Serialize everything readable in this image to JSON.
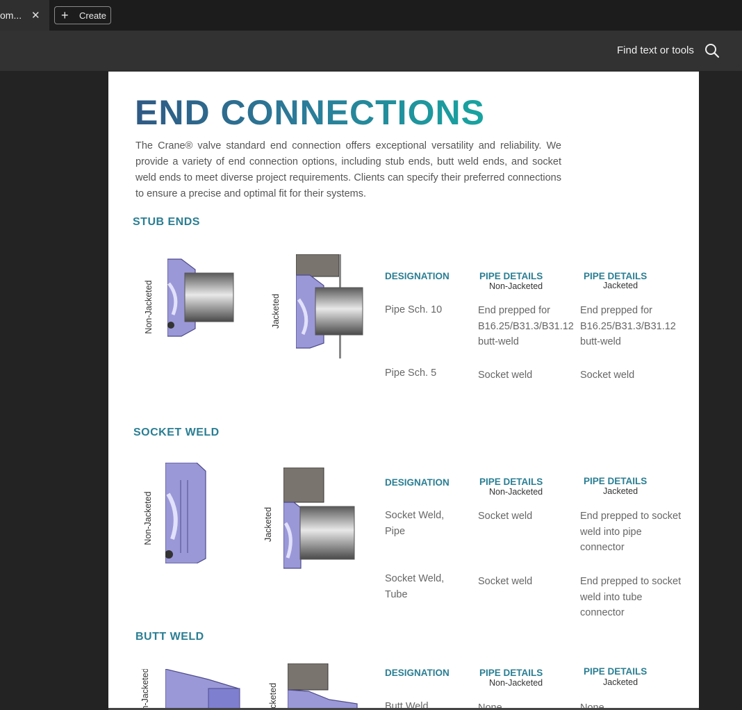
{
  "tabbar": {
    "tab_label": "om...",
    "close_glyph": "✕",
    "create_label": "Create"
  },
  "toolbar": {
    "find_label": "Find text or tools",
    "search_icon": "search-icon"
  },
  "doc": {
    "title": "END CONNECTIONS",
    "intro": "The Crane® valve standard end connection offers exceptional versatility and reliability. We provide a variety of end connection options, including stub ends, butt weld ends, and socket weld ends to meet diverse project requirements. Clients can specify their preferred connections to ensure a precise and optimal fit for their systems.",
    "colors": {
      "accent": "#2a7e93",
      "title_start": "#2f5a84",
      "title_end": "#17a4a0",
      "valve_body": "#9b98d8"
    },
    "sections": [
      {
        "title": "STUB ENDS",
        "label_non": "Non-Jacketed",
        "label_jac": "Jacketed",
        "headers": {
          "designation": "DESIGNATION",
          "pipe": "PIPE DETAILS",
          "non": "Non-Jacketed",
          "jac": "Jacketed"
        },
        "rows": [
          {
            "designation": "Pipe Sch. 10",
            "non": "End prepped for B16.25/B31.3/B31.12 butt-weld",
            "jac": "End prepped for B16.25/B31.3/B31.12 butt-weld"
          },
          {
            "designation": "Pipe Sch. 5",
            "non": "Socket weld",
            "jac": "Socket weld"
          }
        ]
      },
      {
        "title": "SOCKET WELD",
        "label_non": "Non-Jacketed",
        "label_jac": "Jacketed",
        "headers": {
          "designation": "DESIGNATION",
          "pipe": "PIPE DETAILS",
          "non": "Non-Jacketed",
          "jac": "Jacketed"
        },
        "rows": [
          {
            "designation": "Socket Weld, Pipe",
            "non": "Socket weld",
            "jac": "End prepped to socket weld into pipe connector"
          },
          {
            "designation": "Socket Weld, Tube",
            "non": "Socket weld",
            "jac": "End prepped to socket weld into tube connector"
          }
        ]
      },
      {
        "title": "BUTT WELD",
        "label_non": "Non-Jacketed",
        "label_jac": "Jacketed",
        "headers": {
          "designation": "DESIGNATION",
          "pipe": "PIPE DETAILS",
          "non": "Non-Jacketed",
          "jac": "Jacketed"
        },
        "rows": [
          {
            "designation": "Butt Weld",
            "non": "None",
            "jac": "None"
          }
        ]
      }
    ]
  }
}
